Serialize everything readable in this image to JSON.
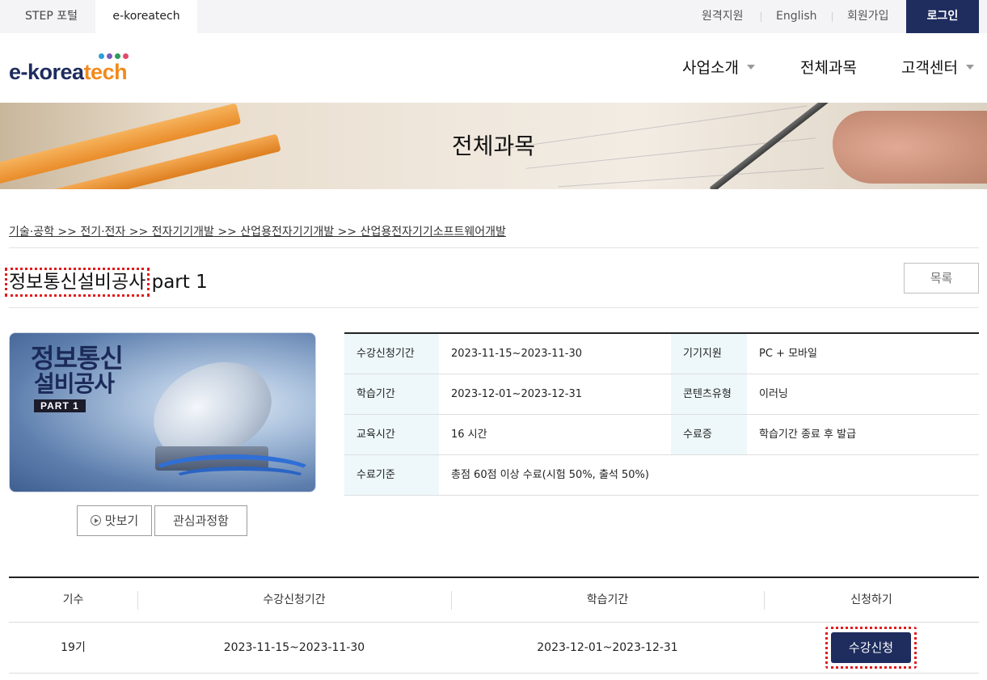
{
  "topbar": {
    "tabs": [
      {
        "label": "STEP 포털"
      },
      {
        "label": "e-koreatech"
      }
    ],
    "links": [
      {
        "label": "원격지원"
      },
      {
        "label": "English"
      },
      {
        "label": "회원가입"
      }
    ],
    "login_label": "로그인"
  },
  "header": {
    "logo": {
      "prefix": "e-korea",
      "suffix": "tech"
    },
    "nav": [
      {
        "label": "사업소개",
        "has_dropdown": true
      },
      {
        "label": "전체과목",
        "has_dropdown": false
      },
      {
        "label": "고객센터",
        "has_dropdown": true
      }
    ]
  },
  "banner": {
    "title": "전체과목"
  },
  "breadcrumb": "기술·공학 >> 전기·전자 >> 전자기기개발 >> 산업용전자기기개발 >> 산업용전자기기소프트웨어개발",
  "course": {
    "title_main": "정보통신설비공사",
    "title_suffix": " part 1",
    "list_button": "목록",
    "thumbnail": {
      "line1": "정보통신",
      "line2": "설비공사",
      "badge": "PART 1"
    },
    "preview_button": "맛보기",
    "wishlist_button": "관심과정함"
  },
  "info": {
    "rows": [
      {
        "th1": "수강신청기간",
        "td1": "2023-11-15~2023-11-30",
        "th2": "기기지원",
        "td2": "PC + 모바일"
      },
      {
        "th1": "학습기간",
        "td1": "2023-12-01~2023-12-31",
        "th2": "콘텐츠유형",
        "td2": "이러닝"
      },
      {
        "th1": "교육시간",
        "td1": "16 시간",
        "th2": "수료증",
        "td2": "학습기간 종료 후 발급"
      },
      {
        "th1": "수료기준",
        "td1": "총점 60점 이상 수료(시험 50%, 출석 50%)"
      }
    ]
  },
  "classes": {
    "headers": [
      "기수",
      "수강신청기간",
      "학습기간",
      "신청하기"
    ],
    "rows": [
      {
        "term": "19기",
        "apply_period": "2023-11-15~2023-11-30",
        "study_period": "2023-12-01~2023-12-31",
        "action": "수강신청"
      }
    ]
  },
  "colors": {
    "navy": "#1e2c5e",
    "orange": "#f28a1c",
    "highlight": "#e21b1b",
    "th_bg": "#eef8fb"
  }
}
